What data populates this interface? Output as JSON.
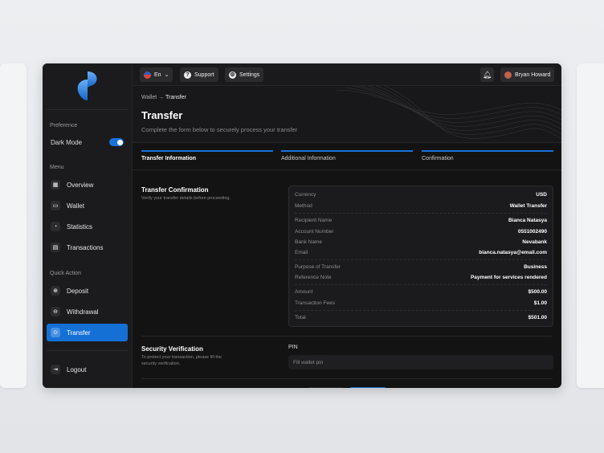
{
  "sidebar": {
    "preference_label": "Preference",
    "dark_mode_label": "Dark Mode",
    "dark_mode_on": true,
    "menu_label": "Menu",
    "menu": [
      {
        "label": "Overview",
        "icon": "grid-icon"
      },
      {
        "label": "Wallet",
        "icon": "wallet-icon"
      },
      {
        "label": "Statistics",
        "icon": "pie-chart-icon"
      },
      {
        "label": "Transactions",
        "icon": "document-icon"
      }
    ],
    "quick_action_label": "Quick Action",
    "quick": [
      {
        "label": "Deposit",
        "icon": "plus-circle-icon"
      },
      {
        "label": "Withdrawal",
        "icon": "download-circle-icon"
      },
      {
        "label": "Transfer",
        "icon": "transfer-icon"
      }
    ],
    "logout_label": "Logout"
  },
  "topbar": {
    "language": "En",
    "support": "Support",
    "settings": "Settings",
    "user_name": "Bryan Howard"
  },
  "page": {
    "breadcrumb": [
      "Wallet",
      "Transfer"
    ],
    "title": "Transfer",
    "subtitle": "Complete the form below to securely process your transfer",
    "steps": [
      "Transfer Information",
      "Additional Information",
      "Confirmation"
    ]
  },
  "confirmation": {
    "title": "Transfer Confirmation",
    "desc": "Verify your transfer details before proceeding.",
    "rows": [
      {
        "k": "Currency",
        "v": "USD"
      },
      {
        "k": "Method",
        "v": "Wallet Transfer"
      },
      {
        "k": "Recipient Name",
        "v": "Bianca Natasya"
      },
      {
        "k": "Account Number",
        "v": "0551002490"
      },
      {
        "k": "Bank Name",
        "v": "Nevabank"
      },
      {
        "k": "Email",
        "v": "bianca.natasya@email.com"
      },
      {
        "k": "Purpose of Transfer",
        "v": "Business"
      },
      {
        "k": "Reference Note",
        "v": "Payment for services rendered"
      },
      {
        "k": "Amount",
        "v": "$500.00"
      },
      {
        "k": "Transaction Fees",
        "v": "$1.00"
      },
      {
        "k": "Total",
        "v": "$501.00"
      }
    ]
  },
  "security": {
    "title": "Security Verification",
    "desc": "To protect your transaction, please fill the security verification.",
    "pin_label": "PIN",
    "pin_placeholder": "Fill wallet pin"
  },
  "colors": {
    "accent": "#1570d6"
  }
}
